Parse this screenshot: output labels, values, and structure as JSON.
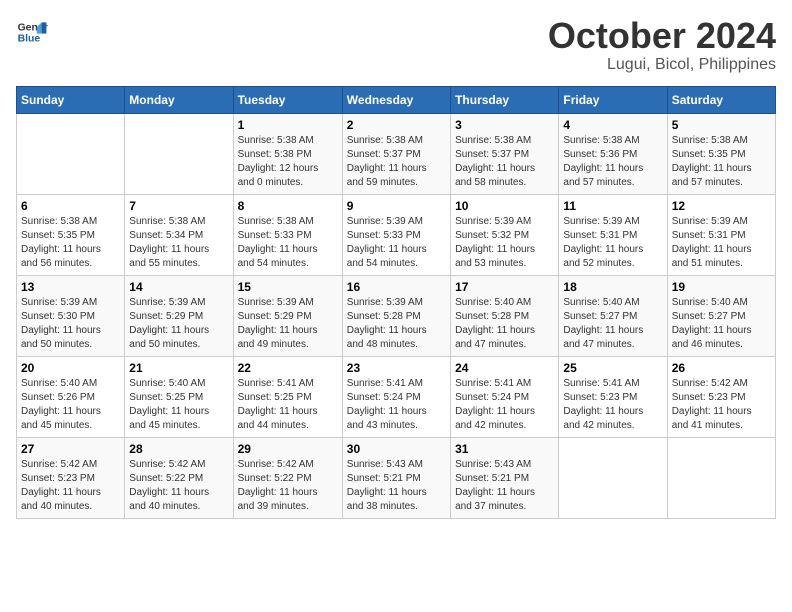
{
  "logo": {
    "text_general": "General",
    "text_blue": "Blue"
  },
  "title": "October 2024",
  "subtitle": "Lugui, Bicol, Philippines",
  "days_of_week": [
    "Sunday",
    "Monday",
    "Tuesday",
    "Wednesday",
    "Thursday",
    "Friday",
    "Saturday"
  ],
  "weeks": [
    [
      {
        "num": "",
        "info": ""
      },
      {
        "num": "",
        "info": ""
      },
      {
        "num": "1",
        "info": "Sunrise: 5:38 AM\nSunset: 5:38 PM\nDaylight: 12 hours\nand 0 minutes."
      },
      {
        "num": "2",
        "info": "Sunrise: 5:38 AM\nSunset: 5:37 PM\nDaylight: 11 hours\nand 59 minutes."
      },
      {
        "num": "3",
        "info": "Sunrise: 5:38 AM\nSunset: 5:37 PM\nDaylight: 11 hours\nand 58 minutes."
      },
      {
        "num": "4",
        "info": "Sunrise: 5:38 AM\nSunset: 5:36 PM\nDaylight: 11 hours\nand 57 minutes."
      },
      {
        "num": "5",
        "info": "Sunrise: 5:38 AM\nSunset: 5:35 PM\nDaylight: 11 hours\nand 57 minutes."
      }
    ],
    [
      {
        "num": "6",
        "info": "Sunrise: 5:38 AM\nSunset: 5:35 PM\nDaylight: 11 hours\nand 56 minutes."
      },
      {
        "num": "7",
        "info": "Sunrise: 5:38 AM\nSunset: 5:34 PM\nDaylight: 11 hours\nand 55 minutes."
      },
      {
        "num": "8",
        "info": "Sunrise: 5:38 AM\nSunset: 5:33 PM\nDaylight: 11 hours\nand 54 minutes."
      },
      {
        "num": "9",
        "info": "Sunrise: 5:39 AM\nSunset: 5:33 PM\nDaylight: 11 hours\nand 54 minutes."
      },
      {
        "num": "10",
        "info": "Sunrise: 5:39 AM\nSunset: 5:32 PM\nDaylight: 11 hours\nand 53 minutes."
      },
      {
        "num": "11",
        "info": "Sunrise: 5:39 AM\nSunset: 5:31 PM\nDaylight: 11 hours\nand 52 minutes."
      },
      {
        "num": "12",
        "info": "Sunrise: 5:39 AM\nSunset: 5:31 PM\nDaylight: 11 hours\nand 51 minutes."
      }
    ],
    [
      {
        "num": "13",
        "info": "Sunrise: 5:39 AM\nSunset: 5:30 PM\nDaylight: 11 hours\nand 50 minutes."
      },
      {
        "num": "14",
        "info": "Sunrise: 5:39 AM\nSunset: 5:29 PM\nDaylight: 11 hours\nand 50 minutes."
      },
      {
        "num": "15",
        "info": "Sunrise: 5:39 AM\nSunset: 5:29 PM\nDaylight: 11 hours\nand 49 minutes."
      },
      {
        "num": "16",
        "info": "Sunrise: 5:39 AM\nSunset: 5:28 PM\nDaylight: 11 hours\nand 48 minutes."
      },
      {
        "num": "17",
        "info": "Sunrise: 5:40 AM\nSunset: 5:28 PM\nDaylight: 11 hours\nand 47 minutes."
      },
      {
        "num": "18",
        "info": "Sunrise: 5:40 AM\nSunset: 5:27 PM\nDaylight: 11 hours\nand 47 minutes."
      },
      {
        "num": "19",
        "info": "Sunrise: 5:40 AM\nSunset: 5:27 PM\nDaylight: 11 hours\nand 46 minutes."
      }
    ],
    [
      {
        "num": "20",
        "info": "Sunrise: 5:40 AM\nSunset: 5:26 PM\nDaylight: 11 hours\nand 45 minutes."
      },
      {
        "num": "21",
        "info": "Sunrise: 5:40 AM\nSunset: 5:25 PM\nDaylight: 11 hours\nand 45 minutes."
      },
      {
        "num": "22",
        "info": "Sunrise: 5:41 AM\nSunset: 5:25 PM\nDaylight: 11 hours\nand 44 minutes."
      },
      {
        "num": "23",
        "info": "Sunrise: 5:41 AM\nSunset: 5:24 PM\nDaylight: 11 hours\nand 43 minutes."
      },
      {
        "num": "24",
        "info": "Sunrise: 5:41 AM\nSunset: 5:24 PM\nDaylight: 11 hours\nand 42 minutes."
      },
      {
        "num": "25",
        "info": "Sunrise: 5:41 AM\nSunset: 5:23 PM\nDaylight: 11 hours\nand 42 minutes."
      },
      {
        "num": "26",
        "info": "Sunrise: 5:42 AM\nSunset: 5:23 PM\nDaylight: 11 hours\nand 41 minutes."
      }
    ],
    [
      {
        "num": "27",
        "info": "Sunrise: 5:42 AM\nSunset: 5:23 PM\nDaylight: 11 hours\nand 40 minutes."
      },
      {
        "num": "28",
        "info": "Sunrise: 5:42 AM\nSunset: 5:22 PM\nDaylight: 11 hours\nand 40 minutes."
      },
      {
        "num": "29",
        "info": "Sunrise: 5:42 AM\nSunset: 5:22 PM\nDaylight: 11 hours\nand 39 minutes."
      },
      {
        "num": "30",
        "info": "Sunrise: 5:43 AM\nSunset: 5:21 PM\nDaylight: 11 hours\nand 38 minutes."
      },
      {
        "num": "31",
        "info": "Sunrise: 5:43 AM\nSunset: 5:21 PM\nDaylight: 11 hours\nand 37 minutes."
      },
      {
        "num": "",
        "info": ""
      },
      {
        "num": "",
        "info": ""
      }
    ]
  ]
}
